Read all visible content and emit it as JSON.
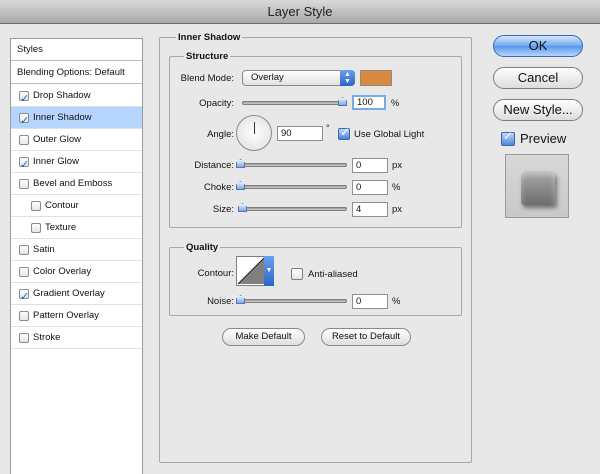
{
  "window": {
    "title": "Layer Style"
  },
  "styles_list": {
    "header": "Styles",
    "blending": "Blending Options: Default",
    "items": [
      {
        "label": "Drop Shadow",
        "checked": true
      },
      {
        "label": "Inner Shadow",
        "checked": true,
        "selected": true
      },
      {
        "label": "Outer Glow",
        "checked": false
      },
      {
        "label": "Inner Glow",
        "checked": true
      },
      {
        "label": "Bevel and Emboss",
        "checked": false
      },
      {
        "label": "Contour",
        "checked": false,
        "indent": true
      },
      {
        "label": "Texture",
        "checked": false,
        "indent": true
      },
      {
        "label": "Satin",
        "checked": false
      },
      {
        "label": "Color Overlay",
        "checked": false
      },
      {
        "label": "Gradient Overlay",
        "checked": true
      },
      {
        "label": "Pattern Overlay",
        "checked": false
      },
      {
        "label": "Stroke",
        "checked": false
      }
    ]
  },
  "inner_shadow": {
    "title": "Inner Shadow",
    "structure": {
      "title": "Structure",
      "blend_mode_label": "Blend Mode:",
      "blend_mode_value": "Overlay",
      "color": "#d98a3e",
      "opacity_label": "Opacity:",
      "opacity_value": "100",
      "opacity_unit": "%",
      "opacity_level": 1.0,
      "angle_label": "Angle:",
      "angle_value": "90",
      "angle_unit": "°",
      "global_light_label": "Use Global Light",
      "global_light_checked": true,
      "distance_label": "Distance:",
      "distance_value": "0",
      "distance_unit": "px",
      "choke_label": "Choke:",
      "choke_value": "0",
      "choke_unit": "%",
      "size_label": "Size:",
      "size_value": "4",
      "size_unit": "px"
    },
    "quality": {
      "title": "Quality",
      "contour_label": "Contour:",
      "anti_aliased_label": "Anti-aliased",
      "anti_aliased_checked": false,
      "noise_label": "Noise:",
      "noise_value": "0",
      "noise_unit": "%"
    },
    "make_default": "Make Default",
    "reset_default": "Reset to Default"
  },
  "buttons": {
    "ok": "OK",
    "cancel": "Cancel",
    "new_style": "New Style...",
    "preview_label": "Preview",
    "preview_checked": true
  }
}
